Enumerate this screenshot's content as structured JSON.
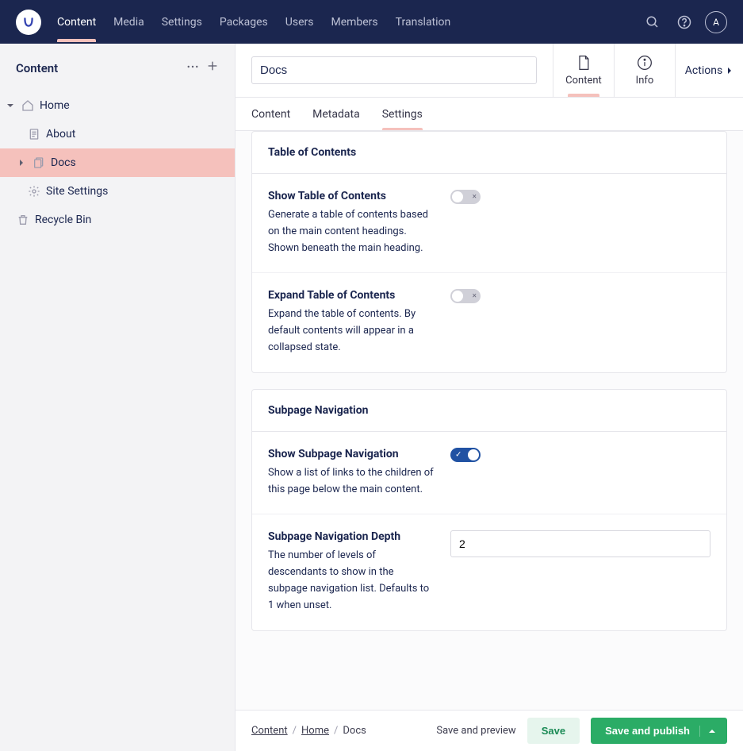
{
  "topbar": {
    "nav": [
      {
        "label": "Content",
        "active": true
      },
      {
        "label": "Media",
        "active": false
      },
      {
        "label": "Settings",
        "active": false
      },
      {
        "label": "Packages",
        "active": false
      },
      {
        "label": "Users",
        "active": false
      },
      {
        "label": "Members",
        "active": false
      },
      {
        "label": "Translation",
        "active": false
      }
    ],
    "avatar_initial": "A"
  },
  "sidebar": {
    "title": "Content",
    "tree": {
      "home": "Home",
      "about": "About",
      "docs": "Docs",
      "site_settings": "Site Settings",
      "recycle_bin": "Recycle Bin"
    }
  },
  "editor": {
    "title_value": "Docs",
    "apptabs": {
      "content": "Content",
      "info": "Info"
    },
    "actions_label": "Actions",
    "subtabs": {
      "content": "Content",
      "metadata": "Metadata",
      "settings": "Settings"
    },
    "cards": {
      "toc": {
        "heading": "Table of Contents",
        "props": {
          "show_toc": {
            "label": "Show Table of Contents",
            "desc": "Generate a table of contents based on the main content headings. Shown beneath the main heading.",
            "value": false
          },
          "expand_toc": {
            "label": "Expand Table of Contents",
            "desc": "Expand the table of contents. By default contents will appear in a collapsed state.",
            "value": false
          }
        }
      },
      "subpage_nav": {
        "heading": "Subpage Navigation",
        "props": {
          "show_spn": {
            "label": "Show Subpage Navigation",
            "desc": "Show a list of links to the children of this page below the main content.",
            "value": true
          },
          "spn_depth": {
            "label": "Subpage Navigation Depth",
            "desc": "The number of levels of descendants to show in the subpage navigation list. Defaults to 1 when unset.",
            "value": "2"
          }
        }
      }
    }
  },
  "footer": {
    "breadcrumb": {
      "root": "Content",
      "home": "Home",
      "current": "Docs"
    },
    "preview_label": "Save and preview",
    "save_label": "Save",
    "publish_label": "Save and publish"
  }
}
